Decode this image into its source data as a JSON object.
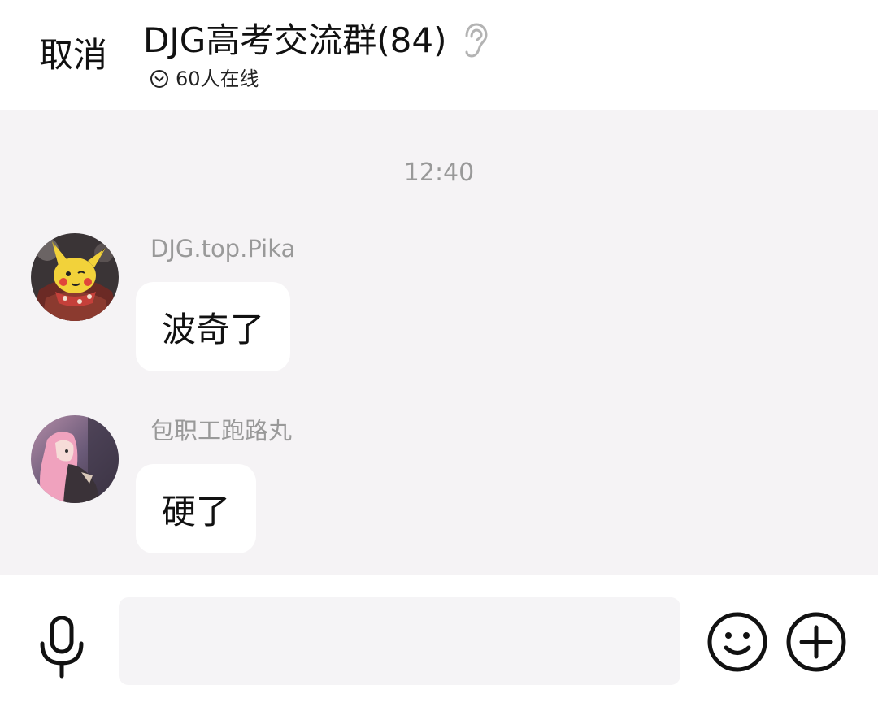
{
  "header": {
    "cancel_label": "取消",
    "group_title": "DJG高考交流群(84)",
    "online_status": "60人在线"
  },
  "chat": {
    "timestamp": "12:40",
    "messages": [
      {
        "sender": "DJG.top.Pika",
        "text": "波奇了",
        "avatar_icon": "pikachu-avatar"
      },
      {
        "sender": "包职工跑路丸",
        "text": "硬了",
        "avatar_icon": "pink-hair-girl-avatar"
      }
    ]
  },
  "input_bar": {
    "placeholder": "",
    "icons": [
      "microphone-icon",
      "emoji-icon",
      "plus-icon"
    ]
  },
  "colors": {
    "chat_background": "#f5f3f5",
    "bubble_background": "#ffffff",
    "secondary_text": "#999999",
    "primary_text": "#111111"
  }
}
